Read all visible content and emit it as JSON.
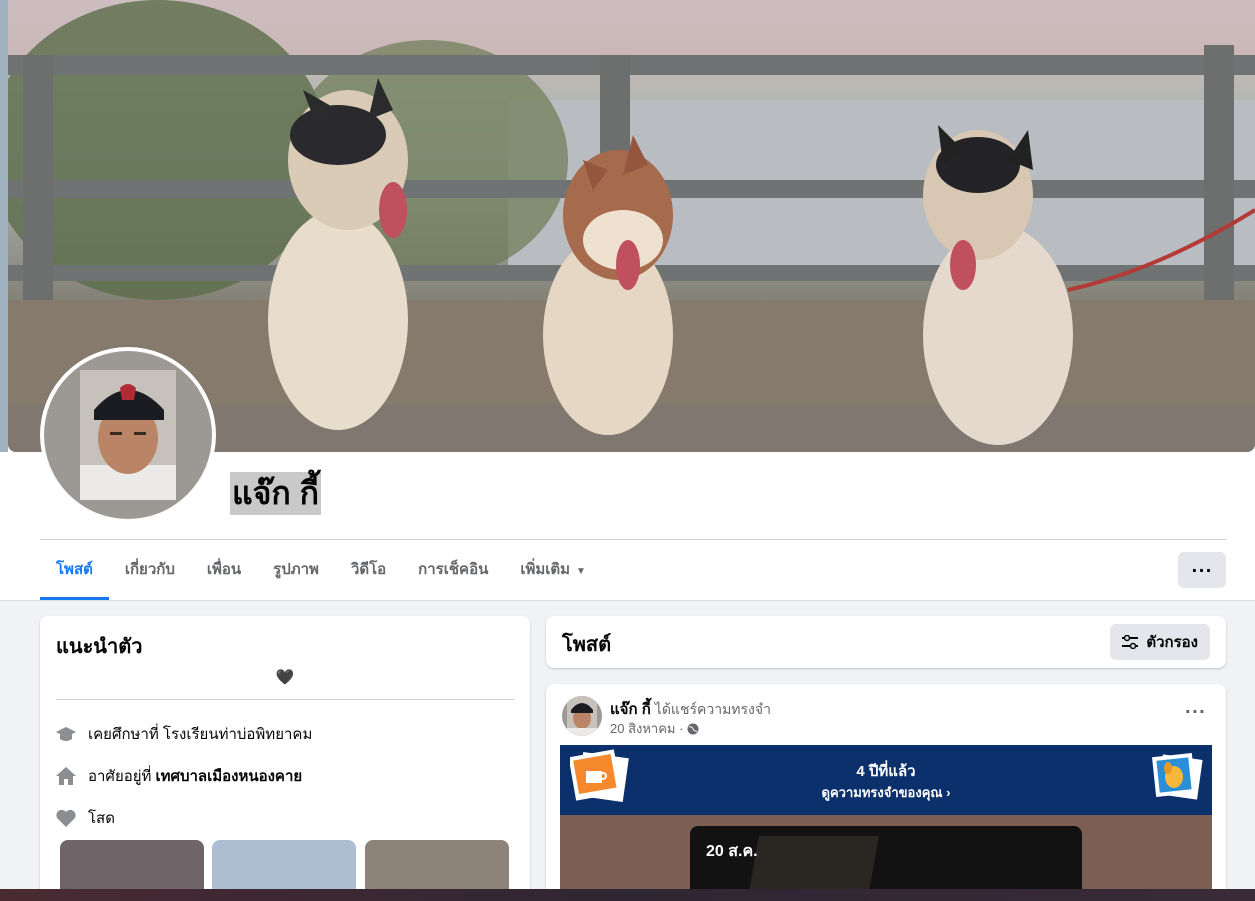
{
  "profile": {
    "name": "แจ๊ก กี้"
  },
  "tabs": [
    {
      "label": "โพสต์",
      "active": true
    },
    {
      "label": "เกี่ยวกับ"
    },
    {
      "label": "เพื่อน"
    },
    {
      "label": "รูปภาพ"
    },
    {
      "label": "วิดีโอ"
    },
    {
      "label": "การเช็คอิน"
    },
    {
      "label": "เพิ่มเติม"
    }
  ],
  "more_button": "···",
  "intro": {
    "title": "แนะนำตัว",
    "bio": "🖤",
    "education_prefix": "เคยศึกษาที่ โรงเรียนท่าบ่อพิทยาคม",
    "location_prefix": "อาศัยอยู่ที่",
    "location_value": "เทศบาลเมืองหนองคาย",
    "relationship": "โสด"
  },
  "posts_section": {
    "title": "โพสต์",
    "filter_label": "ตัวกรอง"
  },
  "post": {
    "author": "แจ๊ก กี้",
    "action": "ได้แชร์ความทรงจำ",
    "date": "20 สิงหาคม ·",
    "menu": "···",
    "memory_years": "4 ปีที่แล้ว",
    "memory_link": "ดูความทรงจำของคุณ",
    "photo_date": "20 ส.ค."
  },
  "colors": {
    "accent": "#1877f2",
    "memory_banner": "#0b306b"
  }
}
